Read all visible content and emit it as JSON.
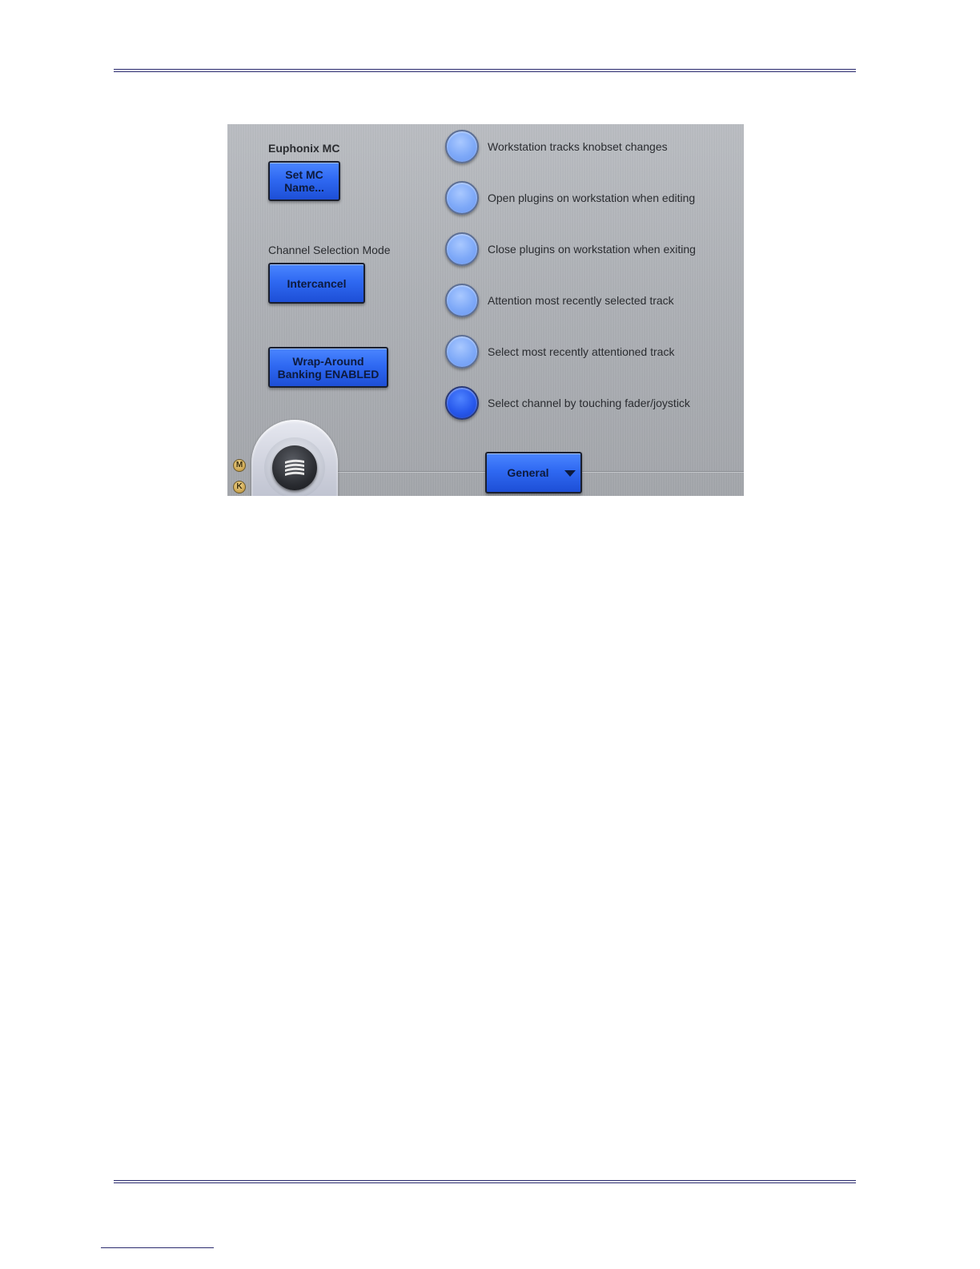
{
  "panel": {
    "title": "Euphonix MC",
    "set_name_button": [
      "Set MC",
      "Name..."
    ],
    "channel_mode_label": "Channel Selection Mode",
    "channel_mode_button": "Intercancel",
    "wrap_button": [
      "Wrap-Around",
      "Banking ENABLED"
    ],
    "options": [
      {
        "label": "Workstation tracks knobset changes",
        "selected": false
      },
      {
        "label": "Open plugins on workstation when editing",
        "selected": false
      },
      {
        "label": "Close plugins on workstation when exiting",
        "selected": false
      },
      {
        "label": "Attention most recently selected track",
        "selected": false
      },
      {
        "label": "Select most recently attentioned track",
        "selected": false
      },
      {
        "label": "Select channel by touching fader/joystick",
        "selected": true
      }
    ],
    "page_dropdown": "General",
    "side_icons": [
      "M",
      "K"
    ],
    "colors": {
      "button_blue": "#2f69f2",
      "toggle_off": "#7ea9f8",
      "toggle_on": "#2758ec"
    }
  }
}
